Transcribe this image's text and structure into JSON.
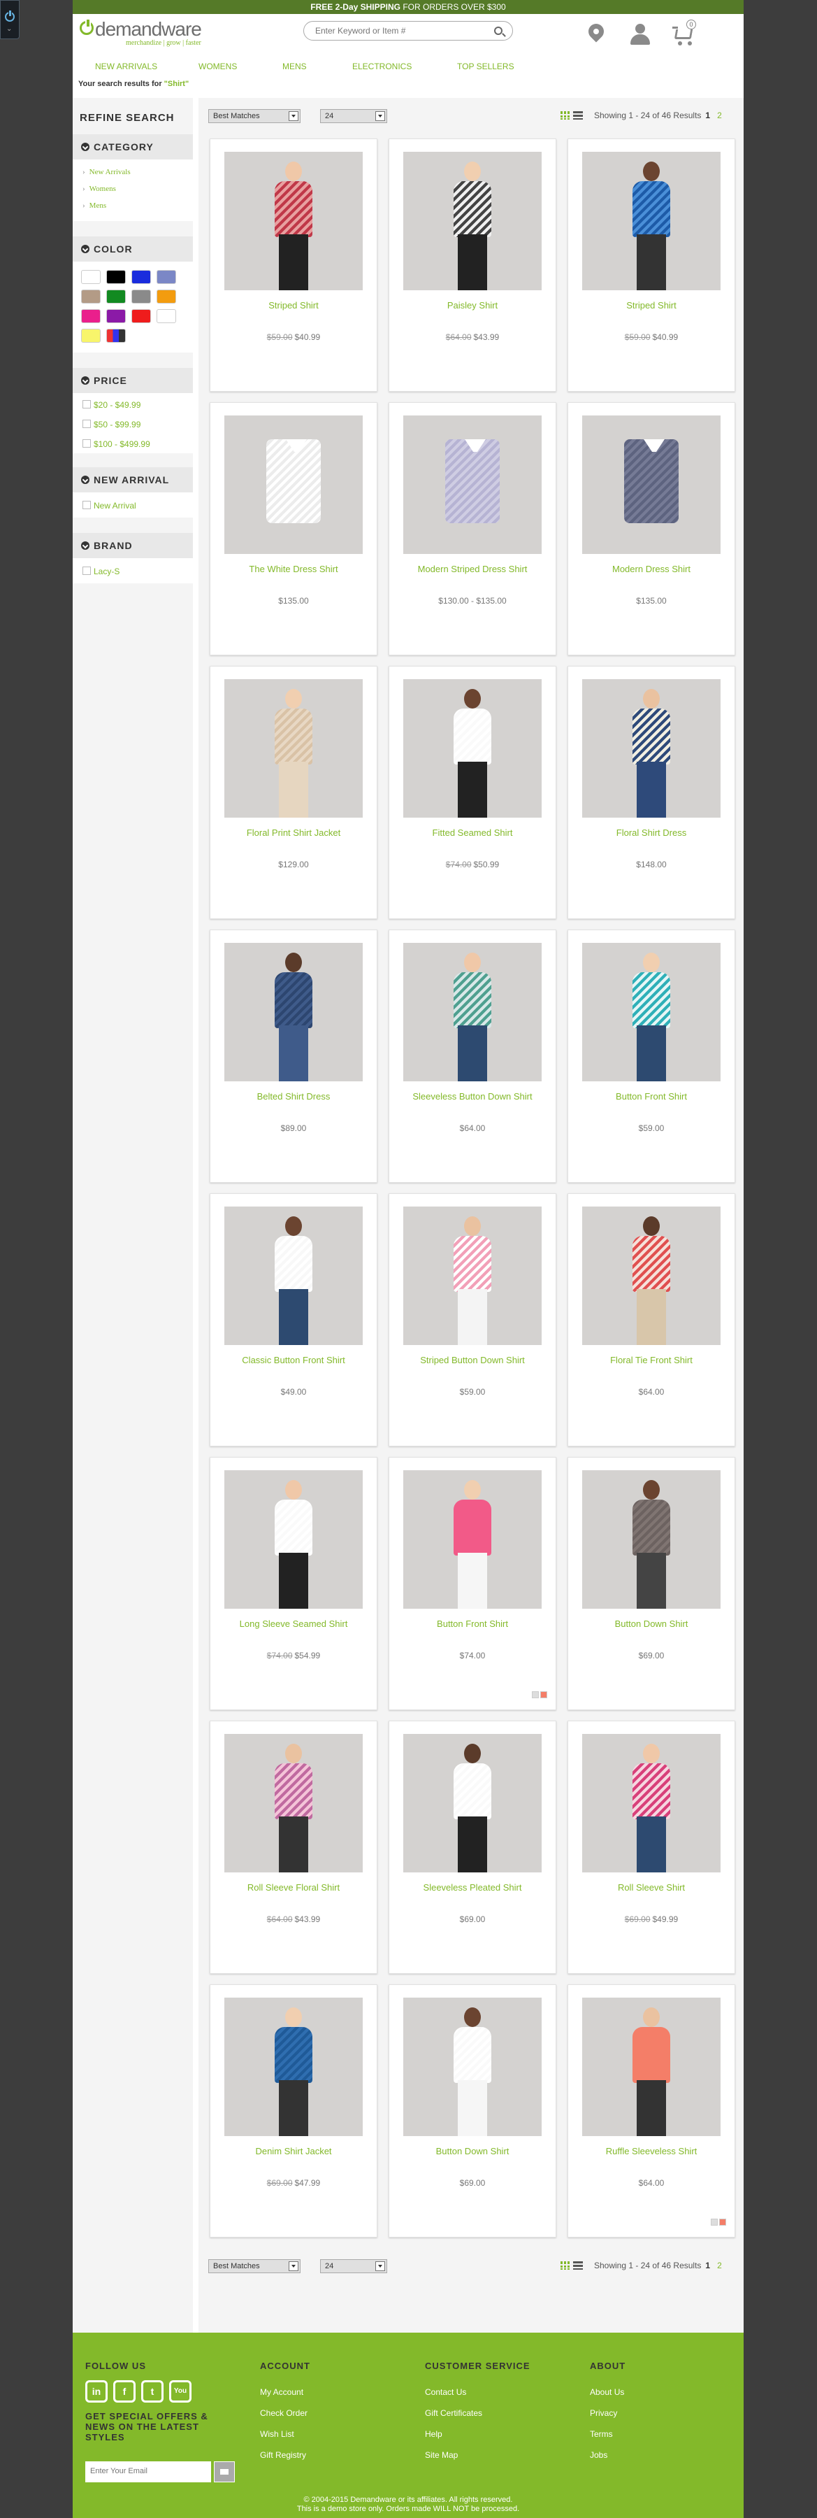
{
  "promo": {
    "bold": "FREE 2-Day SHIPPING",
    "rest": " FOR ORDERS OVER $300"
  },
  "logo": {
    "name": "demandware",
    "tagline": "merchandize | grow | faster"
  },
  "search": {
    "placeholder": "Enter Keyword or Item #"
  },
  "cart": {
    "count": "0"
  },
  "nav": [
    "NEW ARRIVALS",
    "WOMENS",
    "MENS",
    "ELECTRONICS",
    "TOP SELLERS"
  ],
  "results": {
    "prefix": "Your search results for ",
    "query": "\"Shirt\""
  },
  "sidebar": {
    "refine": "REFINE SEARCH",
    "category": {
      "title": "CATEGORY",
      "items": [
        "New Arrivals",
        "Womens",
        "Mens"
      ]
    },
    "color": {
      "title": "COLOR",
      "swatches": [
        "#ffffff",
        "#000000",
        "#1a2cdd",
        "#7b87c6",
        "#b39b86",
        "#128a21",
        "#8a8a8a",
        "#f39c0f",
        "#ea1f8c",
        "#8b1aa7",
        "#ef1c1c",
        "#ffffff",
        "#f8f56b",
        "#miscellaneous"
      ]
    },
    "price": {
      "title": "PRICE",
      "items": [
        "$20 - $49.99",
        "$50 - $99.99",
        "$100 - $499.99"
      ]
    },
    "newarrival": {
      "title": "NEW ARRIVAL",
      "items": [
        "New Arrival"
      ]
    },
    "brand": {
      "title": "BRAND",
      "items": [
        "Lacy-S"
      ]
    }
  },
  "sort": {
    "sort_by": "Best Matches",
    "page_size": "24",
    "showing": "Showing 1 - 24 of 46 Results",
    "page1": "1",
    "page2": "2"
  },
  "products": [
    {
      "name": "Striped Shirt",
      "old": "$59.00",
      "price": "$40.99",
      "theme": "stripes-red"
    },
    {
      "name": "Paisley Shirt",
      "old": "$64.00",
      "price": "$43.99",
      "theme": "paisley"
    },
    {
      "name": "Striped Shirt",
      "old": "$59.00",
      "price": "$40.99",
      "theme": "stripes-blue"
    },
    {
      "name": "The White Dress Shirt",
      "old": "",
      "price": "$135.00",
      "theme": "flat-white"
    },
    {
      "name": "Modern Striped Dress Shirt",
      "old": "",
      "price": "$130.00 - $135.00",
      "theme": "flat-lilac"
    },
    {
      "name": "Modern Dress Shirt",
      "old": "",
      "price": "$135.00",
      "theme": "flat-navy"
    },
    {
      "name": "Floral Print Shirt Jacket",
      "old": "",
      "price": "$129.00",
      "theme": "beige"
    },
    {
      "name": "Fitted Seamed Shirt",
      "old": "$74.00",
      "price": "$50.99",
      "theme": "white-black"
    },
    {
      "name": "Floral Shirt Dress",
      "old": "",
      "price": "$148.00",
      "theme": "dress-floral"
    },
    {
      "name": "Belted Shirt Dress",
      "old": "",
      "price": "$89.00",
      "theme": "dress-denim"
    },
    {
      "name": "Sleeveless Button Down Shirt",
      "old": "",
      "price": "$64.00",
      "theme": "plaid-teal"
    },
    {
      "name": "Button Front Shirt",
      "old": "",
      "price": "$59.00",
      "theme": "teal-print"
    },
    {
      "name": "Classic Button Front Shirt",
      "old": "",
      "price": "$49.00",
      "theme": "white-jeans"
    },
    {
      "name": "Striped Button Down Shirt",
      "old": "",
      "price": "$59.00",
      "theme": "pink-stripes"
    },
    {
      "name": "Floral Tie Front Shirt",
      "old": "",
      "price": "$64.00",
      "theme": "floral-red"
    },
    {
      "name": "Long Sleeve Seamed Shirt",
      "old": "$74.00",
      "price": "$54.99",
      "theme": "white-black"
    },
    {
      "name": "Button Front Shirt",
      "old": "",
      "price": "$74.00",
      "theme": "hotpink"
    },
    {
      "name": "Button Down Shirt",
      "old": "",
      "price": "$69.00",
      "theme": "grey"
    },
    {
      "name": "Roll Sleeve Floral Shirt",
      "old": "$64.00",
      "price": "$43.99",
      "theme": "pink-floral"
    },
    {
      "name": "Sleeveless Pleated Shirt",
      "old": "",
      "price": "$69.00",
      "theme": "white-black"
    },
    {
      "name": "Roll Sleeve Shirt",
      "old": "$69.00",
      "price": "$49.99",
      "theme": "plaid-pink"
    },
    {
      "name": "Denim Shirt Jacket",
      "old": "$69.00",
      "price": "$47.99",
      "theme": "denim"
    },
    {
      "name": "Button Down Shirt",
      "old": "",
      "price": "$69.00",
      "theme": "white-white"
    },
    {
      "name": "Ruffle Sleeveless Shirt",
      "old": "",
      "price": "$64.00",
      "theme": "coral"
    }
  ],
  "footer": {
    "follow": "FOLLOW US",
    "social": [
      "in",
      "f",
      "t",
      "You"
    ],
    "offers": "GET SPECIAL OFFERS & NEWS ON THE LATEST STYLES",
    "email_placeholder": "Enter Your Email",
    "account": {
      "title": "ACCOUNT",
      "links": [
        "My Account",
        "Check Order",
        "Wish List",
        "Gift Registry"
      ]
    },
    "service": {
      "title": "CUSTOMER SERVICE",
      "links": [
        "Contact Us",
        "Gift Certificates",
        "Help",
        "Site Map"
      ]
    },
    "about": {
      "title": "ABOUT",
      "links": [
        "About Us",
        "Privacy",
        "Terms",
        "Jobs"
      ]
    },
    "copyright": "© 2004-2015 Demandware or its affiliates. All rights reserved.",
    "demo_note": "This is a demo store only. Orders made WILL NOT be processed."
  }
}
